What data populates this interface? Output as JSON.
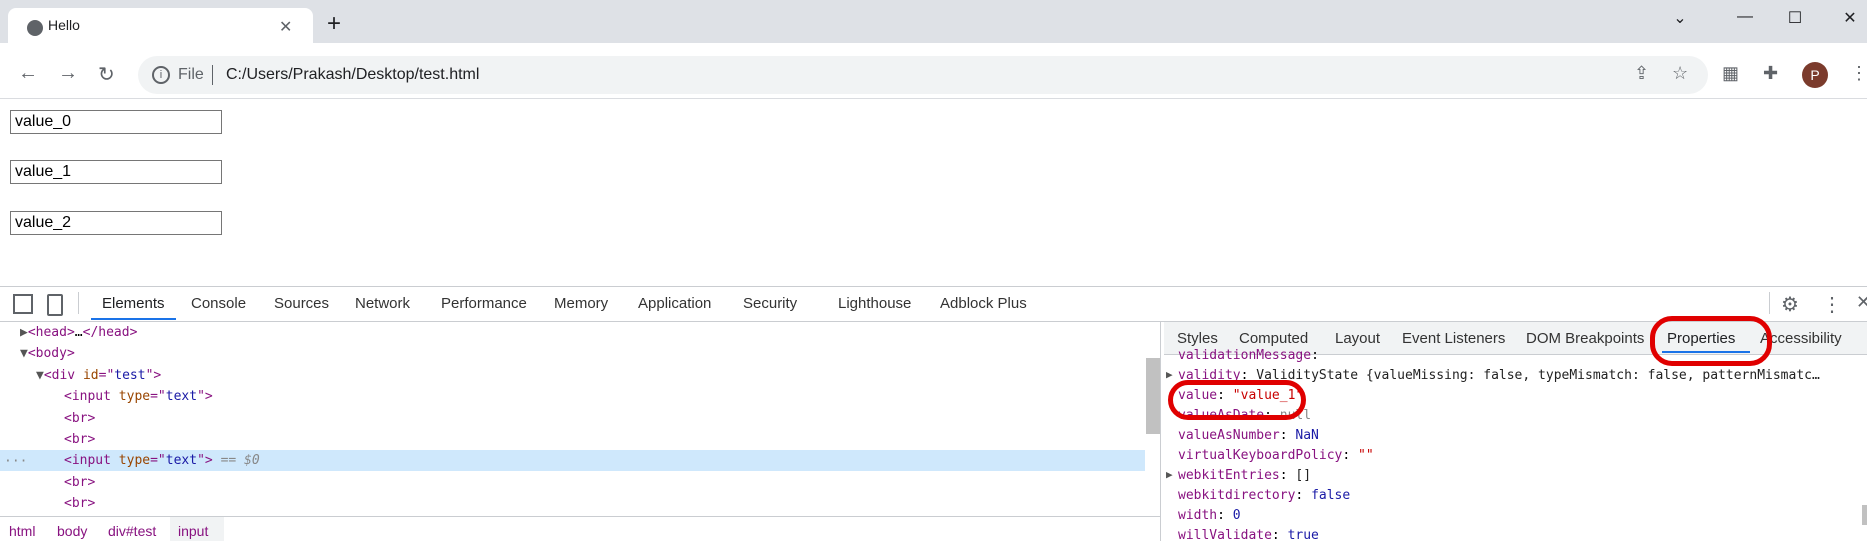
{
  "browser": {
    "tab_title": "Hello",
    "file_label": "File",
    "url": "C:/Users/Prakash/Desktop/test.html",
    "avatar_letter": "P"
  },
  "page": {
    "inputs": [
      "value_0",
      "value_1",
      "value_2"
    ]
  },
  "devtools": {
    "tabs": [
      "Elements",
      "Console",
      "Sources",
      "Network",
      "Performance",
      "Memory",
      "Application",
      "Security",
      "Lighthouse",
      "Adblock Plus"
    ],
    "active_tab": "Elements",
    "dom": {
      "head_line": "…",
      "div_id": "test",
      "input_type": "text",
      "selected_suffix": "== $0"
    },
    "breadcrumbs": [
      "html",
      "body",
      "div#test",
      "input"
    ],
    "side_tabs": [
      "Styles",
      "Computed",
      "Layout",
      "Event Listeners",
      "DOM Breakpoints",
      "Properties",
      "Accessibility"
    ],
    "properties": [
      {
        "key": "validationMessage",
        "value": "",
        "vtype": "str"
      },
      {
        "key": "validity",
        "value": "ValidityState {valueMissing: false, typeMismatch: false, patternMismatc…",
        "vtype": "obj"
      },
      {
        "key": "value",
        "value": "\"value_1\"",
        "vtype": "str"
      },
      {
        "key": "valueAsDate",
        "value": "null",
        "vtype": "num"
      },
      {
        "key": "valueAsNumber",
        "value": "NaN",
        "vtype": "num"
      },
      {
        "key": "virtualKeyboardPolicy",
        "value": "\"\"",
        "vtype": "str"
      },
      {
        "key": "webkitEntries",
        "value": "[]",
        "vtype": "obj"
      },
      {
        "key": "webkitdirectory",
        "value": "false",
        "vtype": "num"
      },
      {
        "key": "width",
        "value": "0",
        "vtype": "num"
      },
      {
        "key": "willValidate",
        "value": "true",
        "vtype": "num"
      }
    ]
  }
}
